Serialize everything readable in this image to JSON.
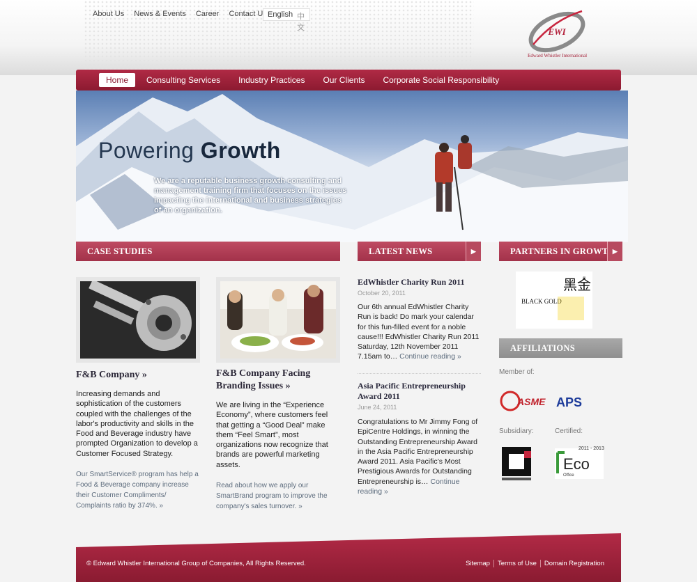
{
  "top_links": [
    "About Us",
    "News & Events",
    "Career",
    "Contact Us"
  ],
  "lang": {
    "english": "English",
    "chinese": "中文"
  },
  "logo": {
    "mark": "EWI",
    "name": "Edward Whistler International"
  },
  "nav": {
    "items": [
      "Home",
      "Consulting Services",
      "Industry Practices",
      "Our Clients",
      "Corporate Social Responsibility"
    ],
    "active": "Home"
  },
  "hero": {
    "title_light": "Powering",
    "title_bold": "Growth",
    "text": "We are a reputable business growth consulting and management training firm that focuses on the issues impacting the international and business strategies of an organization."
  },
  "sections": {
    "case_studies": "CASE STUDIES",
    "latest_news": "LATEST NEWS",
    "partners": "PARTNERS IN GROWTH",
    "affiliations": "AFFILIATIONS",
    "arrow": "▶"
  },
  "cases": [
    {
      "title": "F&B Company »",
      "body": "Increasing demands and sophistication of the customers coupled with the challenges of the labor's productivity and skills in the Food and Beverage industry have prompted Organization to develop a Customer Focused Strategy.",
      "link": "Our SmartService® program has help a Food & Beverage company increase their Customer Compliments/ Complaints ratio by 374%. »"
    },
    {
      "title": "F&B Company Facing Branding Issues »",
      "body": "We are living in the “Experience Economy”, where customers feel that getting a “Good Deal” make them “Feel Smart”, most organizations now recognize that brands are powerful marketing assets.",
      "link": "Read about how we apply our SmartBrand program to improve the company's sales turnover. »"
    }
  ],
  "news": [
    {
      "title": "EdWhistler Charity Run 2011",
      "date": "October 20, 2011",
      "body": "Our 6th annual EdWhistler Charity Run is back! Do mark your calendar for this fun-filled event for a noble cause!!! EdWhistler Charity Run 2011  Saturday, 12th November 2011 7.15am to…",
      "more": "Continue reading »"
    },
    {
      "title": "Asia Pacific Entrepreneurship Award 2011",
      "date": "June 24, 2011",
      "body": "Congratulations to Mr Jimmy Fong of EpiCentre Holdings, in winning the Outstanding Entrepreneurship Award in the Asia Pacific Entrepreneurship Award 2011. Asia Pacific’s Most Prestigious Awards for Outstanding Entrepreneurship is…",
      "more": "Continue reading »"
    }
  ],
  "partner_logo": {
    "text": "BLACK GOLD",
    "chars": "黑金",
    "reg": "®"
  },
  "affiliations": {
    "member_label": "Member of:",
    "subsidiary_label": "Subsidiary:",
    "certified_label": "Certified:",
    "asme": "ASME",
    "aps": "APS",
    "eco": "Eco",
    "eco_sub": "Office",
    "eco_years": "2011 - 2013"
  },
  "footer": {
    "copyright": "© Edward Whistler International Group of Companies, All Rights Reserved.",
    "links": [
      "Sitemap",
      "Terms of Use",
      "Domain Registration"
    ]
  },
  "colors": {
    "brand": "#9b2139",
    "section": "#b03e56",
    "text": "#222222"
  }
}
